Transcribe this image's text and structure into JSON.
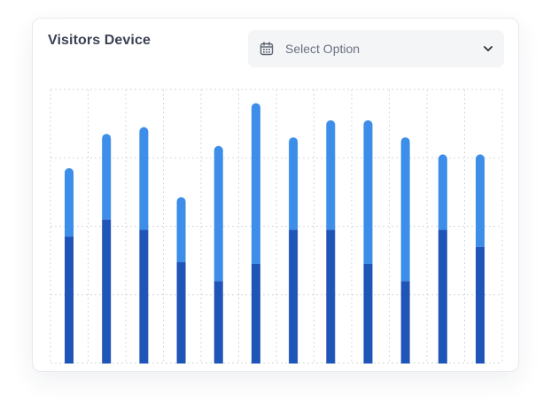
{
  "card": {
    "title": "Visitors Device"
  },
  "select": {
    "label": "Select Option",
    "icon_left": "calendar-icon",
    "icon_right": "chevron-down-icon"
  },
  "colors": {
    "dark_segment": "#2055b8",
    "light_segment": "#3d8ee8",
    "grid": "#d5d9e0"
  },
  "chart_data": {
    "type": "bar",
    "stacked": true,
    "ylim": [
      0,
      160
    ],
    "grid": true,
    "categories": [
      "",
      "",
      "",
      "",
      "",
      "",
      "",
      "",
      "",
      "",
      "",
      ""
    ],
    "series": [
      {
        "values": [
          74,
          84,
          78,
          59,
          48,
          58,
          78,
          78,
          58,
          48,
          78,
          68
        ]
      },
      {
        "values": [
          40,
          50,
          60,
          38,
          79,
          94,
          54,
          64,
          84,
          84,
          44,
          54
        ]
      }
    ]
  }
}
